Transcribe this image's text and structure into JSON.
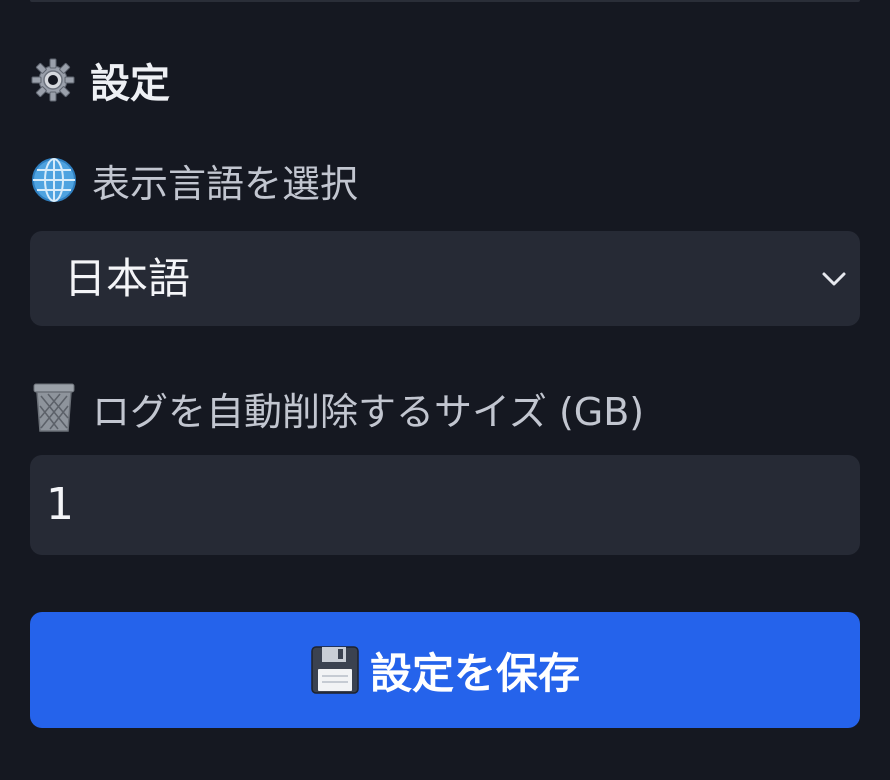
{
  "settings": {
    "title": "設定",
    "title_icon": "gear-icon",
    "language": {
      "icon": "globe-icon",
      "label": "表示言語を選択",
      "selected": "日本語",
      "dropdown_icon": "chevron-down-icon"
    },
    "log_size": {
      "icon": "wastebasket-icon",
      "label": "ログを自動削除するサイズ (GB)",
      "value": "1"
    },
    "save_button": {
      "icon": "floppy-disk-icon",
      "label": "設定を保存"
    }
  },
  "colors": {
    "background": "#151821",
    "input_background": "#262a35",
    "accent": "#2563eb",
    "label_text": "#c2c6d0",
    "primary_text": "#eef0f4"
  }
}
